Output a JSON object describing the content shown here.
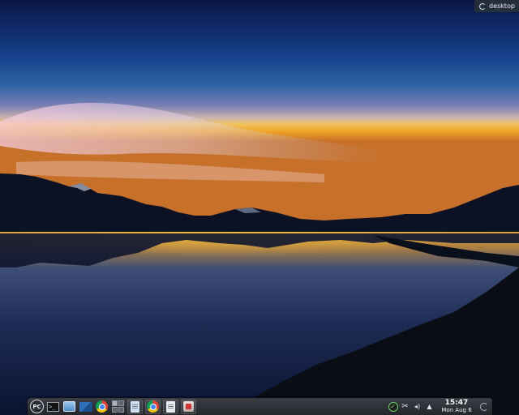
{
  "desktop": {
    "activity_label": "desktop",
    "wallpaper": "mountain-lake-sunset"
  },
  "panel": {
    "launcher_label": "PC",
    "terminal_glyph": ">_",
    "launchers": [
      "terminal-icon",
      "file-manager-icon",
      "writer-icon",
      "chrome-icon"
    ],
    "tasks": [
      "document-icon",
      "chrome-icon",
      "text-editor-icon",
      "package-manager-icon"
    ]
  },
  "tray": {
    "icons": [
      "update-check-icon",
      "clipboard-scissors-icon",
      "volume-icon",
      "expand-tray-icon"
    ],
    "volume_glyph": "◂)",
    "expand_glyph": "▲",
    "scissors_glyph": "✂",
    "check_glyph": "✓"
  },
  "clock": {
    "time": "15:47",
    "date": "Mon Aug 6"
  },
  "colors": {
    "sky_top": "#0c1a4a",
    "horizon": "#f3a623",
    "panel": "#2c2f33"
  }
}
